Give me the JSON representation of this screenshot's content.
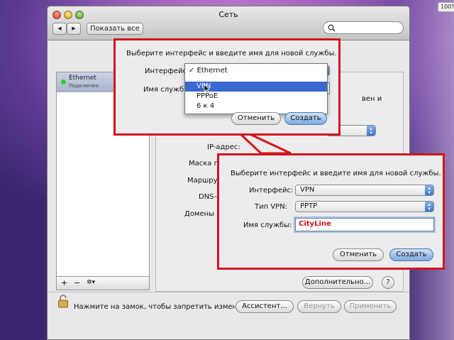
{
  "overlay_badge": "100%",
  "window": {
    "title": "Сеть",
    "show_all": "Показать все",
    "nav_back": "◀",
    "nav_fwd": "▶"
  },
  "sidebar": {
    "item_name": "Ethernet",
    "item_status": "Подключен",
    "add": "+",
    "remove": "−",
    "gear": "✲▾"
  },
  "pane": {
    "desc_tail": "вен и",
    "ip_label": "IP-адрес:",
    "mask_label": "Маска по",
    "router_label": "Маршрути",
    "dns_label": "DNS-с",
    "domains_label": "Домены п",
    "advanced": "Дополнительно...",
    "help": "?"
  },
  "bottom": {
    "lock_text": "Нажмите на замок, чтобы запретить изменения.",
    "assistant": "Ассистент...",
    "revert": "Вернуть",
    "apply": "Применить"
  },
  "dialog1": {
    "prompt": "Выберите интерфейс и введите имя для новой службы.",
    "interface_label": "Интерфейс",
    "name_label": "Имя службы",
    "cancel": "Отменить",
    "create": "Создать",
    "menu": {
      "checked": "Ethernet",
      "items": [
        "VPN",
        "PPPoE",
        "6 к 4"
      ]
    }
  },
  "dialog2": {
    "prompt": "Выберите интерфейс и введите имя для новой службы.",
    "interface_label": "Интерфейс:",
    "interface_value": "VPN",
    "vpn_type_label": "Тип VPN:",
    "vpn_type_value": "PPTP",
    "name_label": "Имя службы:",
    "name_value": "CityLine",
    "cancel": "Отменить",
    "create": "Создать"
  },
  "colors": {
    "callout_border": "#d2141e",
    "selection": "#3a67d1",
    "name_text": "#d2141e"
  }
}
